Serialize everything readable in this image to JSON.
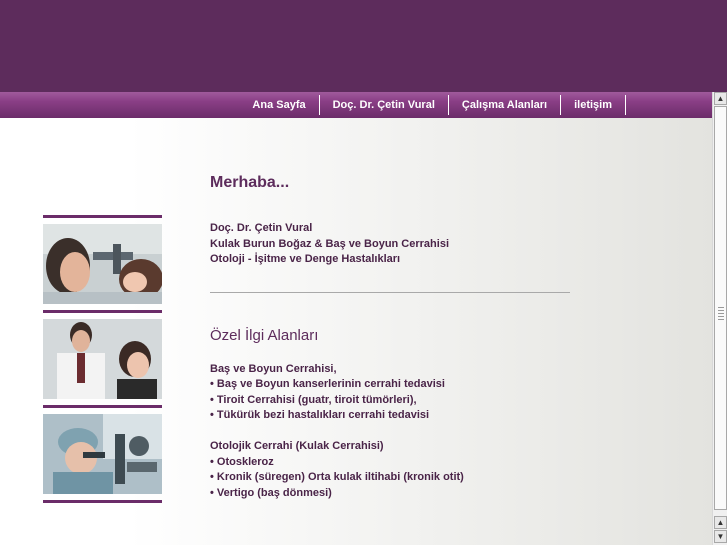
{
  "nav": {
    "items": [
      {
        "label": "Ana Sayfa"
      },
      {
        "label": "Doç. Dr. Çetin Vural"
      },
      {
        "label": "Çalışma Alanları"
      },
      {
        "label": "iletişim"
      }
    ]
  },
  "content": {
    "greeting": "Merhaba...",
    "intro": [
      "Doç. Dr. Çetin Vural",
      "Kulak Burun Boğaz & Baş ve Boyun Cerrahisi",
      "Otoloji - İşitme ve Denge Hastalıkları"
    ],
    "section_title": "Özel İlgi Alanları",
    "group1": [
      "Baş ve Boyun Cerrahisi,",
      "• Baş ve Boyun kanserlerinin cerrahi tedavisi",
      "• Tiroit Cerrahisi (guatr, tiroit tümörleri),",
      "• Tükürük bezi hastalıkları cerrahi tedavisi"
    ],
    "group2": [
      "Otolojik Cerrahi (Kulak Cerrahisi)",
      "• Otoskleroz",
      "• Kronik (süregen) Orta kulak iltihabi (kronik otit)",
      "• Vertigo (baş dönmesi)"
    ]
  },
  "colors": {
    "header": "#5d2c5c",
    "accent": "#6b2c69",
    "text": "#4a2448"
  },
  "scrollbar": {
    "up_icon": "arrow-up-icon",
    "down_icon": "arrow-down-icon",
    "up_glyph": "▲",
    "down_glyph": "▼"
  }
}
